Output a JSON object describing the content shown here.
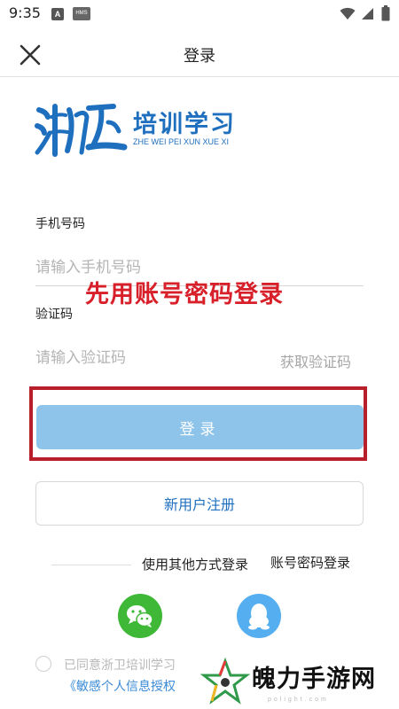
{
  "status_bar": {
    "time": "9:35",
    "left_icons": [
      "notification-a-icon",
      "hms-icon"
    ],
    "hms_label": "HMS",
    "a_label": "A",
    "right_icons": [
      "wifi-icon",
      "signal-icon",
      "battery-icon"
    ]
  },
  "header": {
    "close_icon": "close-icon",
    "title": "登录"
  },
  "logo": {
    "name_cn": "培训学习",
    "pinyin": "ZHE WEI PEI XUN XUE XI"
  },
  "form": {
    "phone_label": "手机号码",
    "phone_placeholder": "请输入手机号码",
    "phone_value": "",
    "code_label": "验证码",
    "code_placeholder": "请输入验证码",
    "code_value": "",
    "get_code_label": "获取验证码",
    "login_button": "登录",
    "register_button": "新用户注册"
  },
  "annotation": {
    "overlay_text": "先用账号密码登录",
    "highlight_color": "#b71f2b",
    "text_color": "#d8202a"
  },
  "other_login": {
    "label": "使用其他方式登录",
    "account_password_login": "账号密码登录",
    "methods": [
      "wechat-icon",
      "qq-icon"
    ]
  },
  "agreement": {
    "text": "已同意浙卫培训学习",
    "privacy_link": "《敏感个人信息授权"
  },
  "watermark": {
    "text": "魄力手游网",
    "sub": "polight.com"
  },
  "colors": {
    "brand_blue": "#1f6fbf",
    "login_button_bg": "#8ec4ea",
    "wechat_green": "#3fb838",
    "qq_blue": "#54aef0",
    "link_blue": "#3a8bd6"
  }
}
